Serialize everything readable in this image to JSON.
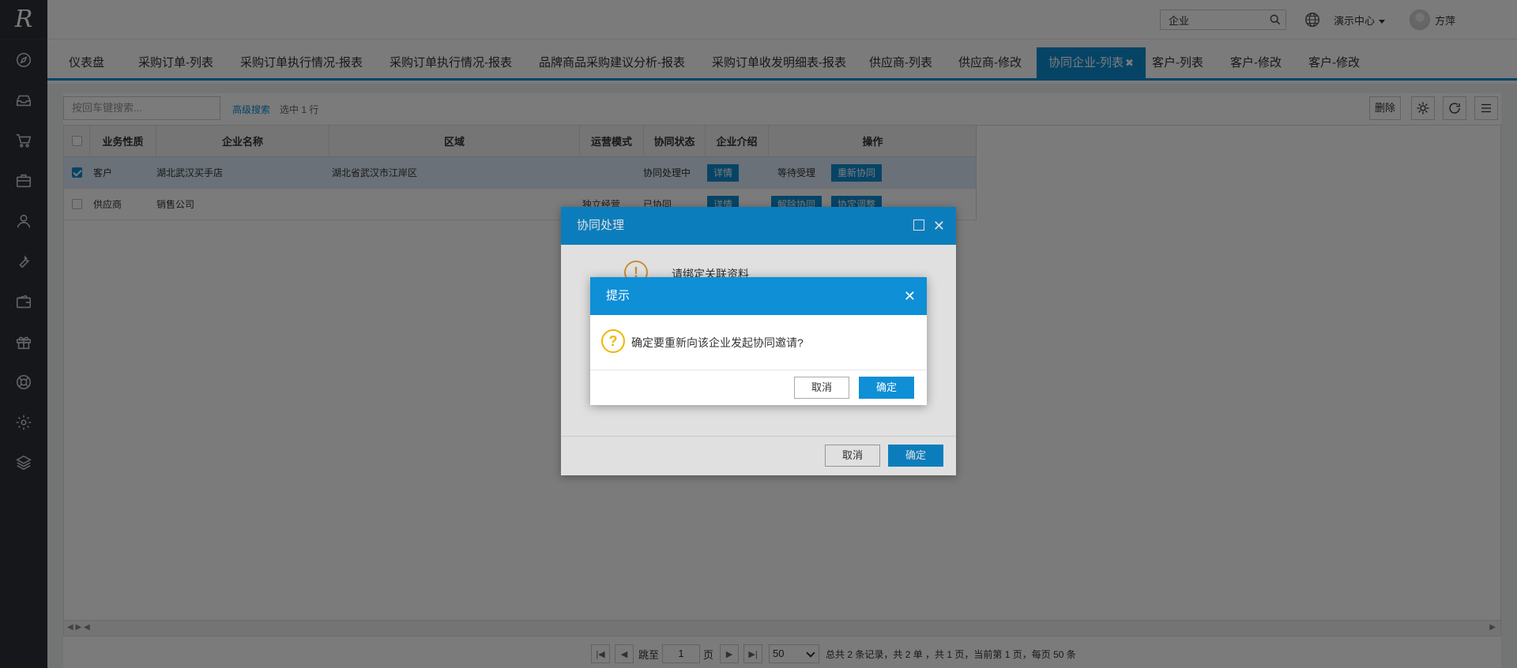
{
  "sidebar": {
    "logo": "R",
    "icons": [
      "compass-icon",
      "inbox-icon",
      "cart-icon",
      "briefcase-icon",
      "user-icon",
      "wrench-icon",
      "wallet-icon",
      "gift-icon",
      "lifebuoy-icon",
      "gear-icon",
      "layers-icon"
    ]
  },
  "topbar": {
    "search_value": "企业",
    "center_label": "演示中心",
    "user_name": "方萍",
    "help_glyph": "?"
  },
  "tabs": [
    {
      "label": "仪表盘"
    },
    {
      "label": "采购订单-列表"
    },
    {
      "label": "采购订单执行情况-报表"
    },
    {
      "label": "采购订单执行情况-报表"
    },
    {
      "label": "品牌商品采购建议分析-报表"
    },
    {
      "label": "采购订单收发明细表-报表"
    },
    {
      "label": "供应商-列表"
    },
    {
      "label": "供应商-修改"
    },
    {
      "label": "协同企业-列表",
      "active": true
    },
    {
      "label": "客户-列表"
    },
    {
      "label": "客户-修改"
    },
    {
      "label": "客户-修改"
    }
  ],
  "toolbar": {
    "search_placeholder": "按回车键搜索...",
    "advanced_search": "高级搜索",
    "selection_info": "选中 1 行",
    "delete_label": "删除"
  },
  "table": {
    "headers": [
      "业务性质",
      "企业名称",
      "区域",
      "运营模式",
      "协同状态",
      "企业介绍",
      "操作"
    ],
    "rows": [
      {
        "selected": true,
        "type": "客户",
        "name": "湖北武汉买手店",
        "region": "湖北省武汉市江岸区",
        "mode": "",
        "status": "协同处理中",
        "intro_btn": "详情",
        "op_text": "等待受理",
        "op_btn": "重新协同"
      },
      {
        "selected": false,
        "type": "供应商",
        "name": "销售公司",
        "region": "",
        "mode": "独立经营",
        "status": "已协同",
        "intro_btn": "详情",
        "op_btn1": "解除协同",
        "op_btn2": "协定调整"
      }
    ]
  },
  "pager": {
    "jump_label": "跳至",
    "page_value": "1",
    "page_unit": "页",
    "page_size": "50",
    "summary": "总共 2 条记录，共 2 单 ，共 1 页，当前第 1 页，每页 50 条"
  },
  "dialog1": {
    "title": "协同处理",
    "message": "请绑定关联资料",
    "cancel": "取消",
    "ok": "确定"
  },
  "dialog2": {
    "title": "提示",
    "message": "确定要重新向该企业发起协同邀请?",
    "cancel": "取消",
    "ok": "确定"
  },
  "colors": {
    "accent": "#0e8fd6",
    "sidebar": "#2f3237",
    "warning": "#f2b600"
  }
}
